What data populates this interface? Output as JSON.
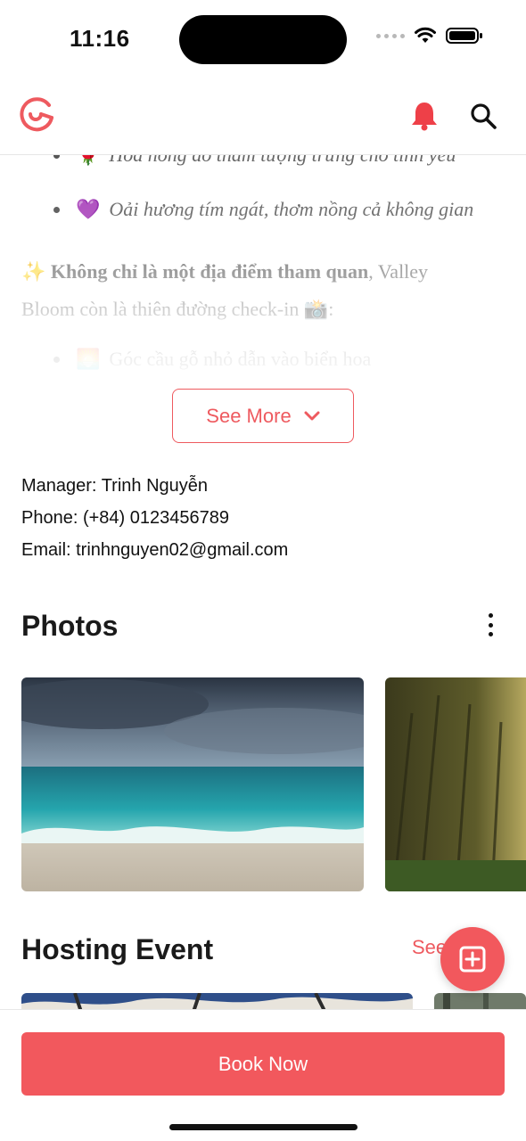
{
  "status": {
    "time": "11:16"
  },
  "description": {
    "bullets": [
      {
        "emoji": "🌹",
        "text": "Hoa hồng đỏ thắm tượng trưng cho tình yêu"
      },
      {
        "emoji": "💜",
        "text": "Oải hương tím ngát, thơm nồng cả không gian"
      }
    ],
    "para_emoji": "✨",
    "para_bold": "Không chỉ là một địa điểm tham quan",
    "para_rest": ", Valley Bloom còn là thiên đường check-in 📸:",
    "bullet3_emoji": "🌅",
    "bullet3_text": "Góc cầu gỗ nhỏ dẫn vào biển hoa"
  },
  "see_more": {
    "label": "See More"
  },
  "contact": {
    "manager": "Manager: Trinh Nguyễn",
    "phone": "Phone: (+84) 0123456789",
    "email": "Email: trinhnguyen02@gmail.com"
  },
  "photos": {
    "title": "Photos"
  },
  "hosting_event": {
    "title": "Hosting Event",
    "see_all": "See"
  },
  "book_now": {
    "label": "Book Now"
  },
  "colors": {
    "accent": "#f2585d",
    "outline": "#ee5a5f"
  },
  "icons": [
    "logo-icon",
    "bell-icon",
    "search-icon",
    "chevron-down-icon",
    "more-vertical-icon",
    "add-square-icon"
  ]
}
